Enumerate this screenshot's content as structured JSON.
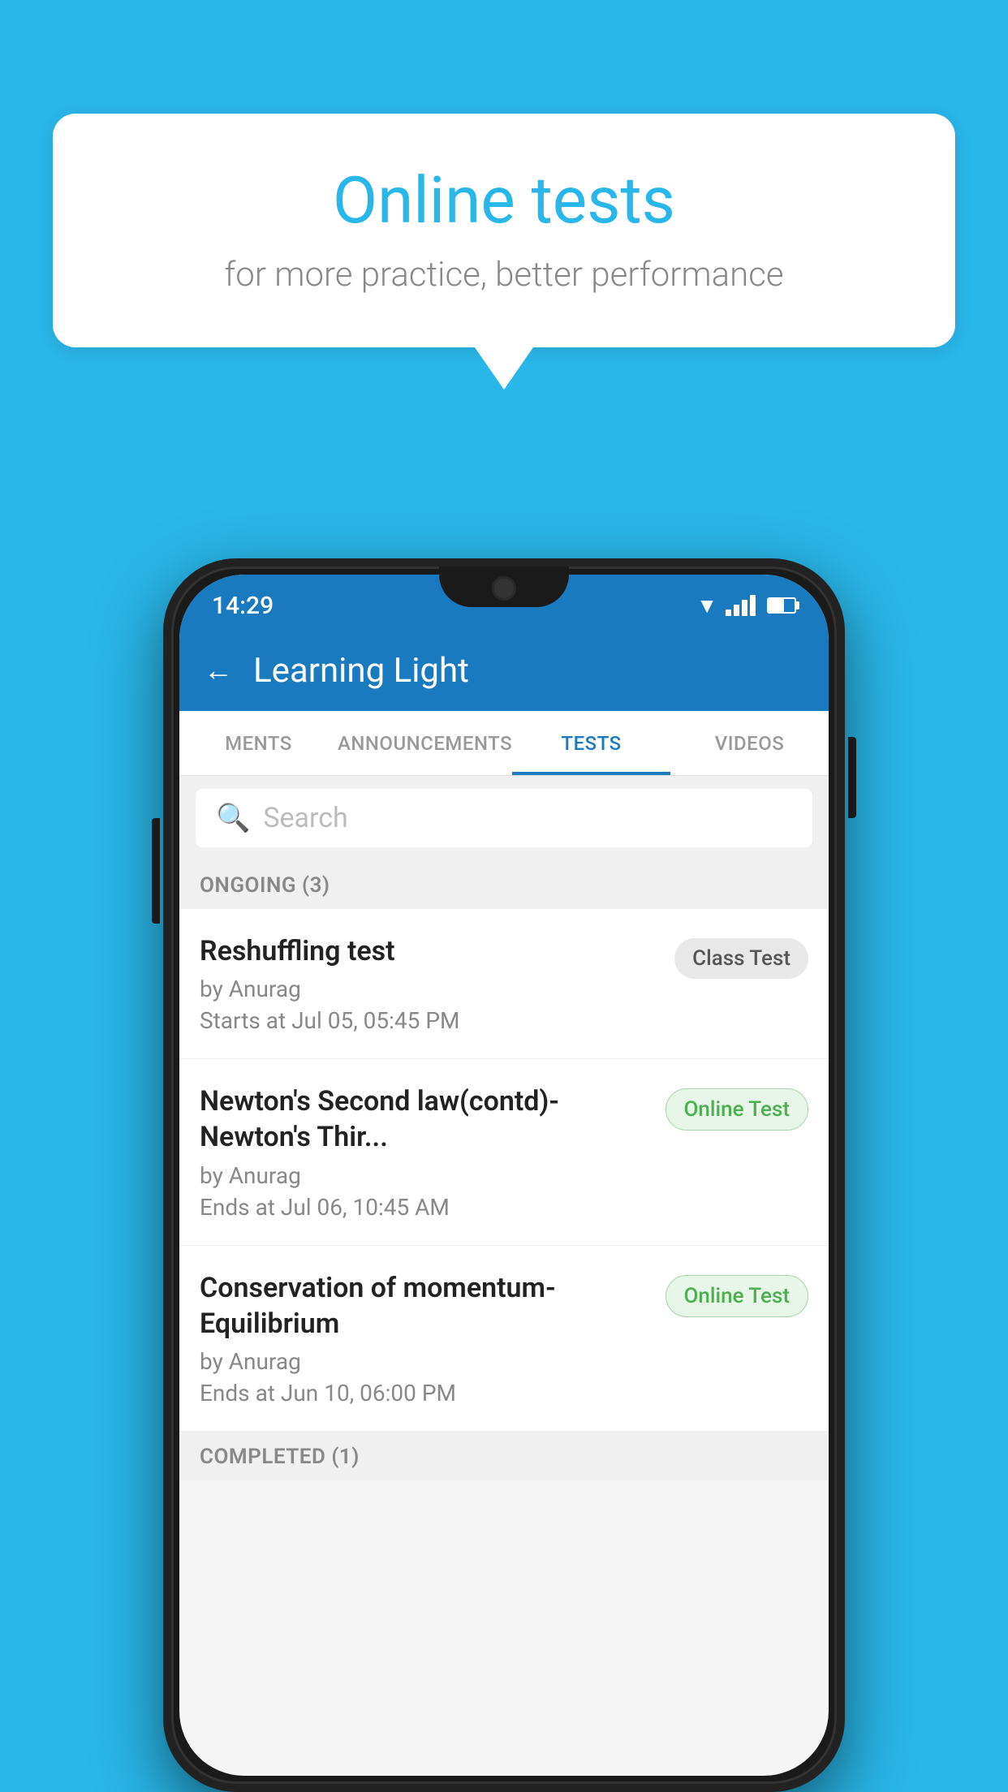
{
  "background_color": "#29b6e8",
  "speech_bubble": {
    "title": "Online tests",
    "subtitle": "for more practice, better performance"
  },
  "status_bar": {
    "time": "14:29"
  },
  "app_header": {
    "title": "Learning Light",
    "back_label": "←"
  },
  "tabs": [
    {
      "label": "MENTS",
      "active": false
    },
    {
      "label": "ANNOUNCEMENTS",
      "active": false
    },
    {
      "label": "TESTS",
      "active": true
    },
    {
      "label": "VIDEOS",
      "active": false
    }
  ],
  "search": {
    "placeholder": "Search"
  },
  "ongoing_section": {
    "title": "ONGOING (3)"
  },
  "tests": [
    {
      "name": "Reshuffling test",
      "author": "by Anurag",
      "time_label": "Starts at",
      "time": "Jul 05, 05:45 PM",
      "badge": "Class Test",
      "badge_type": "class"
    },
    {
      "name": "Newton's Second law(contd)-Newton's Thir...",
      "author": "by Anurag",
      "time_label": "Ends at",
      "time": "Jul 06, 10:45 AM",
      "badge": "Online Test",
      "badge_type": "online"
    },
    {
      "name": "Conservation of momentum-Equilibrium",
      "author": "by Anurag",
      "time_label": "Ends at",
      "time": "Jun 10, 06:00 PM",
      "badge": "Online Test",
      "badge_type": "online"
    }
  ],
  "completed_section": {
    "title": "COMPLETED (1)"
  }
}
